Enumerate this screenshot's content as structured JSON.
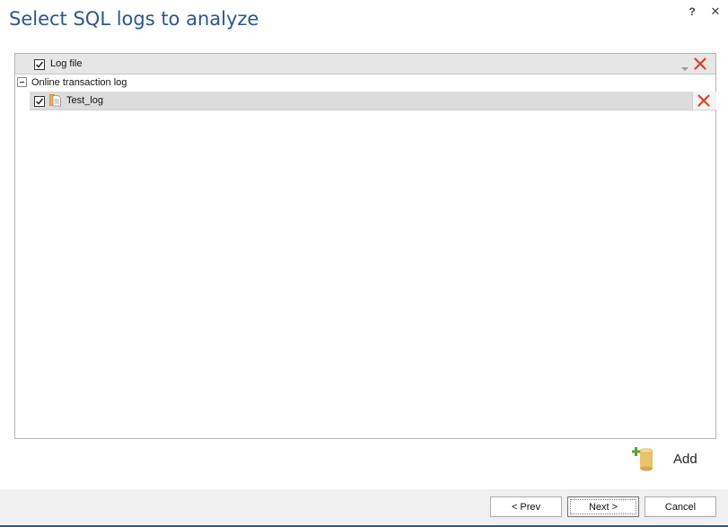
{
  "dialog": {
    "title": "Select SQL logs to analyze",
    "help_label": "?",
    "close_label": "✕"
  },
  "grid": {
    "column_header": "Log file",
    "header_checked": true,
    "groups": [
      {
        "label": "Online transaction log",
        "expanded": true,
        "rows": [
          {
            "label": "Test_log",
            "checked": true
          }
        ]
      }
    ]
  },
  "actions": {
    "add_label": "Add"
  },
  "footer": {
    "prev_label": "< Prev",
    "next_label": "Next >",
    "cancel_label": "Cancel"
  },
  "colors": {
    "title": "#2a5697",
    "remove_icon": "#d9442b",
    "add_plus": "#5aa63a",
    "add_cylinder": "#e8c36a"
  },
  "icons": {
    "header_filter": "dropdown-arrow-icon",
    "remove": "red-x-icon",
    "row_file": "log-file-icon",
    "add": "add-database-icon"
  }
}
